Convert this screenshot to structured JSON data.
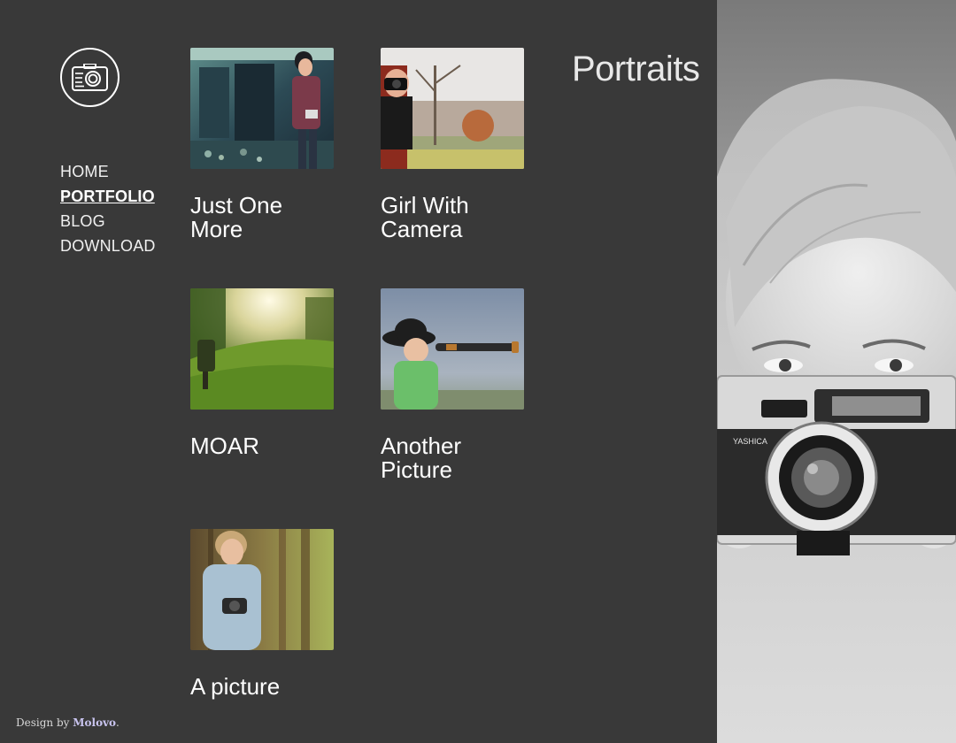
{
  "logo": {
    "icon": "camera-icon"
  },
  "nav": {
    "items": [
      {
        "label": "HOME"
      },
      {
        "label": "PORTFOLIO",
        "active": true
      },
      {
        "label": "BLOG"
      },
      {
        "label": "DOWNLOAD"
      }
    ]
  },
  "section": {
    "title": "Portraits"
  },
  "gallery": {
    "items": [
      {
        "caption_line1": "Just One",
        "caption_line2": "More"
      },
      {
        "caption_line1": "Girl With",
        "caption_line2": "Camera"
      },
      {
        "caption_line1": "MOAR",
        "caption_line2": ""
      },
      {
        "caption_line1": "Another",
        "caption_line2": "Picture"
      },
      {
        "caption_line1": "A picture",
        "caption_line2": ""
      }
    ]
  },
  "footer": {
    "credit_prefix": "Design by ",
    "credit_name": "Molovo",
    "credit_suffix": "."
  },
  "colors": {
    "background": "#393939",
    "text": "#ffffff",
    "credit_link": "#c9c4ef"
  }
}
